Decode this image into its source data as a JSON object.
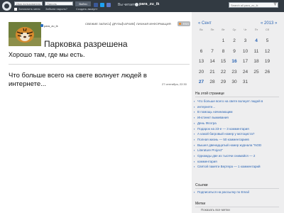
{
  "topbar": {
    "login_placeholder": "Имя пользователя",
    "password_placeholder": "Пароль",
    "login_button": "Войти",
    "remember_label": "Запомнить меня",
    "forgot_label": "Забыли пароль?",
    "create_label": "Создать аккаунт",
    "you_browse_label": "Вы читаете",
    "user_name": "para_zu_ik",
    "search_placeholder": "Search all para_zu_ik"
  },
  "blog": {
    "username": "para_zu_ik",
    "nav": [
      "СВЕЖИЕ ЗАПИСИ",
      "ДРУЗЬЯ",
      "АРХИВ",
      "ЛИЧНАЯ ИНФОРМАЦИЯ"
    ],
    "rss_label": "RSS"
  },
  "post": {
    "title": "Парковка разрешена",
    "body": "Хорошо там, где мы есть."
  },
  "post2": {
    "text": "Что больше всего на свете волнует людей в интернете...",
    "date": "27 сентября, 22:30"
  },
  "calendar": {
    "prev": "« Сент",
    "year": "« 2013 »",
    "dow": [
      "Вс",
      "Пн",
      "Вт",
      "Ср",
      "Чт",
      "Пт",
      "Сб"
    ],
    "rows": [
      [
        "",
        "",
        "1",
        "2",
        "3",
        "4",
        "5"
      ],
      [
        "6",
        "7",
        "8",
        "9",
        "10",
        "11",
        "12"
      ],
      [
        "13",
        "14",
        "15",
        "16",
        "17",
        "18",
        "19"
      ],
      [
        "20",
        "21",
        "22",
        "23",
        "24",
        "25",
        "26"
      ],
      [
        "27",
        "28",
        "29",
        "30",
        "31",
        "",
        ""
      ]
    ],
    "links": [
      "4",
      "16",
      "27"
    ]
  },
  "sidebar": {
    "page_heading": "На этой странице",
    "items": [
      {
        "text": "Что больше всего на свете волнует людей в"
      },
      {
        "text": "интернете..."
      },
      {
        "text": "В помощь начинающим"
      },
      {
        "text": "Инстинкт выживания"
      },
      {
        "text": "День Флэтра"
      },
      {
        "text": "Подарок на 23-е",
        "tail": " — 3 комментария"
      },
      {
        "text": "А какой багровый номер у мотоциста?"
      },
      {
        "text": "Полная жизнь",
        "tail": " — 50 комментариев"
      },
      {
        "text": "Вышел двенадцатый номер журнала \"NOD"
      },
      {
        "text": "Literature Project\""
      },
      {
        "text": "Однажды две из тысячи снимайся",
        "tail": " — 2"
      },
      {
        "text": "комментария"
      },
      {
        "text": "Святой памяти Вертера",
        "tail": " — 1 комментарий"
      }
    ],
    "links_heading": "Ссылки",
    "links_item": "Подписаться на рассылку по Email",
    "tags_heading": "Метки",
    "tags_hint": "Показать все метки"
  },
  "colors": {
    "topbar": "#323a42",
    "link": "#2a64b4",
    "sidebar": "#eeeeef"
  }
}
